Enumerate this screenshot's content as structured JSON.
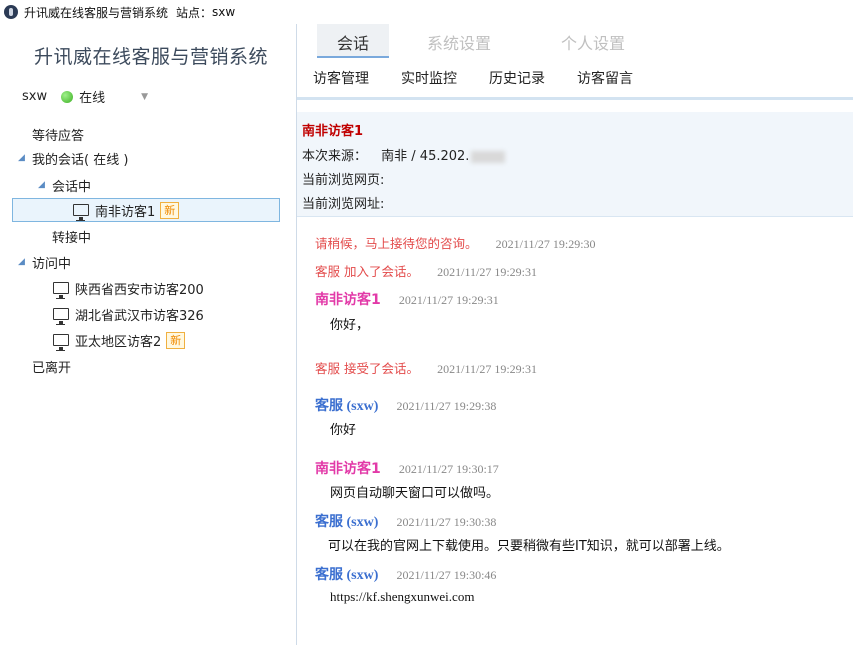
{
  "window": {
    "title": "升讯威在线客服与营销系统",
    "site_label": "站点：",
    "site_value": "sxw"
  },
  "sidebar": {
    "brand": "升讯威在线客服与营销系统",
    "user": "sxw",
    "status": "在线",
    "tree": {
      "waiting": "等待应答",
      "my_sessions": "我的会话( 在线 )",
      "in_session": "会话中",
      "current_visitor": "南非访客1",
      "new_badge": "新",
      "transferring": "转接中",
      "visiting": "访问中",
      "visitors": [
        {
          "name": "陕西省西安市访客200",
          "badge": ""
        },
        {
          "name": "湖北省武汉市访客326",
          "badge": ""
        },
        {
          "name": "亚太地区访客2",
          "badge": "新"
        }
      ],
      "left": "已离开"
    }
  },
  "tabs": {
    "top": [
      "会话",
      "系统设置",
      "个人设置"
    ],
    "sub": [
      "访客管理",
      "实时监控",
      "历史记录",
      "访客留言"
    ]
  },
  "visitor_info": {
    "name": "南非访客1",
    "source_label": "本次来源：",
    "source_value": "南非  /  45.202.",
    "page_label": "当前浏览网页:",
    "url_label": "当前浏览网址:"
  },
  "chat": {
    "messages": [
      {
        "type": "system",
        "text": "请稍候，马上接待您的咨询。",
        "time": "2021/11/27 19:29:30"
      },
      {
        "type": "system",
        "text": "客服 加入了会话。",
        "time": "2021/11/27 19:29:31"
      },
      {
        "type": "visitor",
        "sender": "南非访客1",
        "time": "2021/11/27 19:29:31",
        "text": "你好，"
      },
      {
        "type": "system",
        "text": "客服 接受了会话。",
        "time": "2021/11/27 19:29:31"
      },
      {
        "type": "agent",
        "sender": "客服 (sxw)",
        "time": "2021/11/27 19:29:38",
        "text": "你好"
      },
      {
        "type": "visitor",
        "sender": "南非访客1",
        "time": "2021/11/27 19:30:17",
        "text": "网页自动聊天窗口可以做吗。"
      },
      {
        "type": "agent",
        "sender": "客服 (sxw)",
        "time": "2021/11/27 19:30:38",
        "text": "可以在我的官网上下载使用。只要稍微有些IT知识，就可以部署上线。"
      },
      {
        "type": "agent",
        "sender": "客服 (sxw)",
        "time": "2021/11/27 19:30:46",
        "text": "https://kf.shengxunwei.com"
      }
    ]
  },
  "colors": {
    "system_text": "#e34b4b",
    "visitor_name": "#e23aa8",
    "agent_name": "#3b6fd0",
    "visitor_info_name": "#c00000",
    "online_dot": "#3cb023"
  }
}
